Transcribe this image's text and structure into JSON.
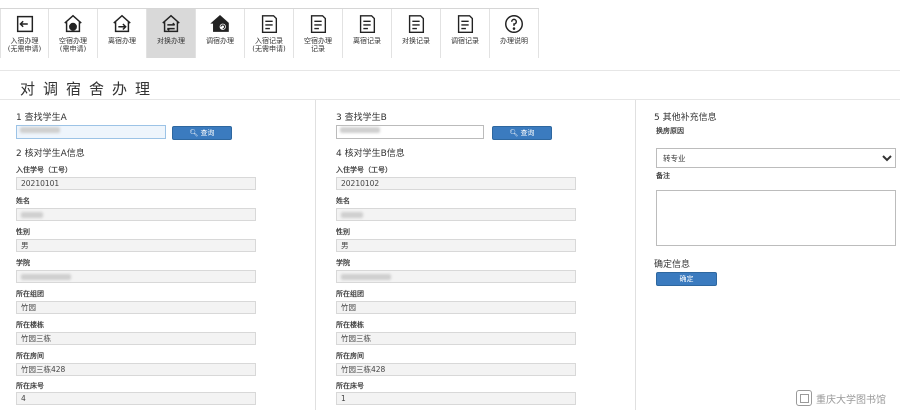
{
  "toolbar": {
    "items": [
      {
        "label": "入宿办理",
        "sub": "(无需申请)",
        "icon": "arrow-left-box-icon"
      },
      {
        "label": "空宿办理",
        "sub": "(需申请)",
        "icon": "house-globe-icon"
      },
      {
        "label": "离宿办理",
        "sub": "",
        "icon": "arrow-right-box-icon"
      },
      {
        "label": "对换办理",
        "sub": "",
        "icon": "house-swap-icon"
      },
      {
        "label": "调宿办理",
        "sub": "",
        "icon": "house-refresh-icon"
      },
      {
        "label": "入宿记录",
        "sub": "(无需申请)",
        "icon": "doc-in-icon"
      },
      {
        "label": "空宿办理",
        "sub": "记录",
        "icon": "doc-empty-icon"
      },
      {
        "label": "离宿记录",
        "sub": "",
        "icon": "doc-out-icon"
      },
      {
        "label": "对换记录",
        "sub": "",
        "icon": "doc-swap-icon"
      },
      {
        "label": "调宿记录",
        "sub": "",
        "icon": "doc-adjust-icon"
      },
      {
        "label": "办理说明",
        "sub": "",
        "icon": "question-circle-icon"
      }
    ]
  },
  "page_title": "对调宿舍办理",
  "student_a": {
    "find_title": "1 查找学生A",
    "search_label": "查询",
    "verify_title": "2 核对学生A信息",
    "fields": [
      {
        "label": "入住学号（工号）",
        "value": "20210101"
      },
      {
        "label": "姓名",
        "value": ""
      },
      {
        "label": "性别",
        "value": "男"
      },
      {
        "label": "学院",
        "value": ""
      },
      {
        "label": "所在组团",
        "value": "竹园"
      },
      {
        "label": "所在楼栋",
        "value": "竹园三栋"
      },
      {
        "label": "所在房间",
        "value": "竹园三栋428"
      },
      {
        "label": "所在床号",
        "value": "4"
      }
    ]
  },
  "student_b": {
    "find_title": "3 查找学生B",
    "search_label": "查询",
    "verify_title": "4 核对学生B信息",
    "fields": [
      {
        "label": "入住学号（工号）",
        "value": "20210102"
      },
      {
        "label": "姓名",
        "value": ""
      },
      {
        "label": "性别",
        "value": "男"
      },
      {
        "label": "学院",
        "value": ""
      },
      {
        "label": "所在组团",
        "value": "竹园"
      },
      {
        "label": "所在楼栋",
        "value": "竹园三栋"
      },
      {
        "label": "所在房间",
        "value": "竹园三栋428"
      },
      {
        "label": "所在床号",
        "value": "1"
      }
    ]
  },
  "extra": {
    "title": "5 其他补充信息",
    "reason_label": "换房原因",
    "reason_value": "转专业",
    "remark_label": "备注",
    "confirm_title": "确定信息",
    "confirm_button": "确定"
  },
  "watermark": "重庆大学图书馆",
  "colors": {
    "accent": "#3b7bbf",
    "active_tab": "#d9d9d9"
  }
}
